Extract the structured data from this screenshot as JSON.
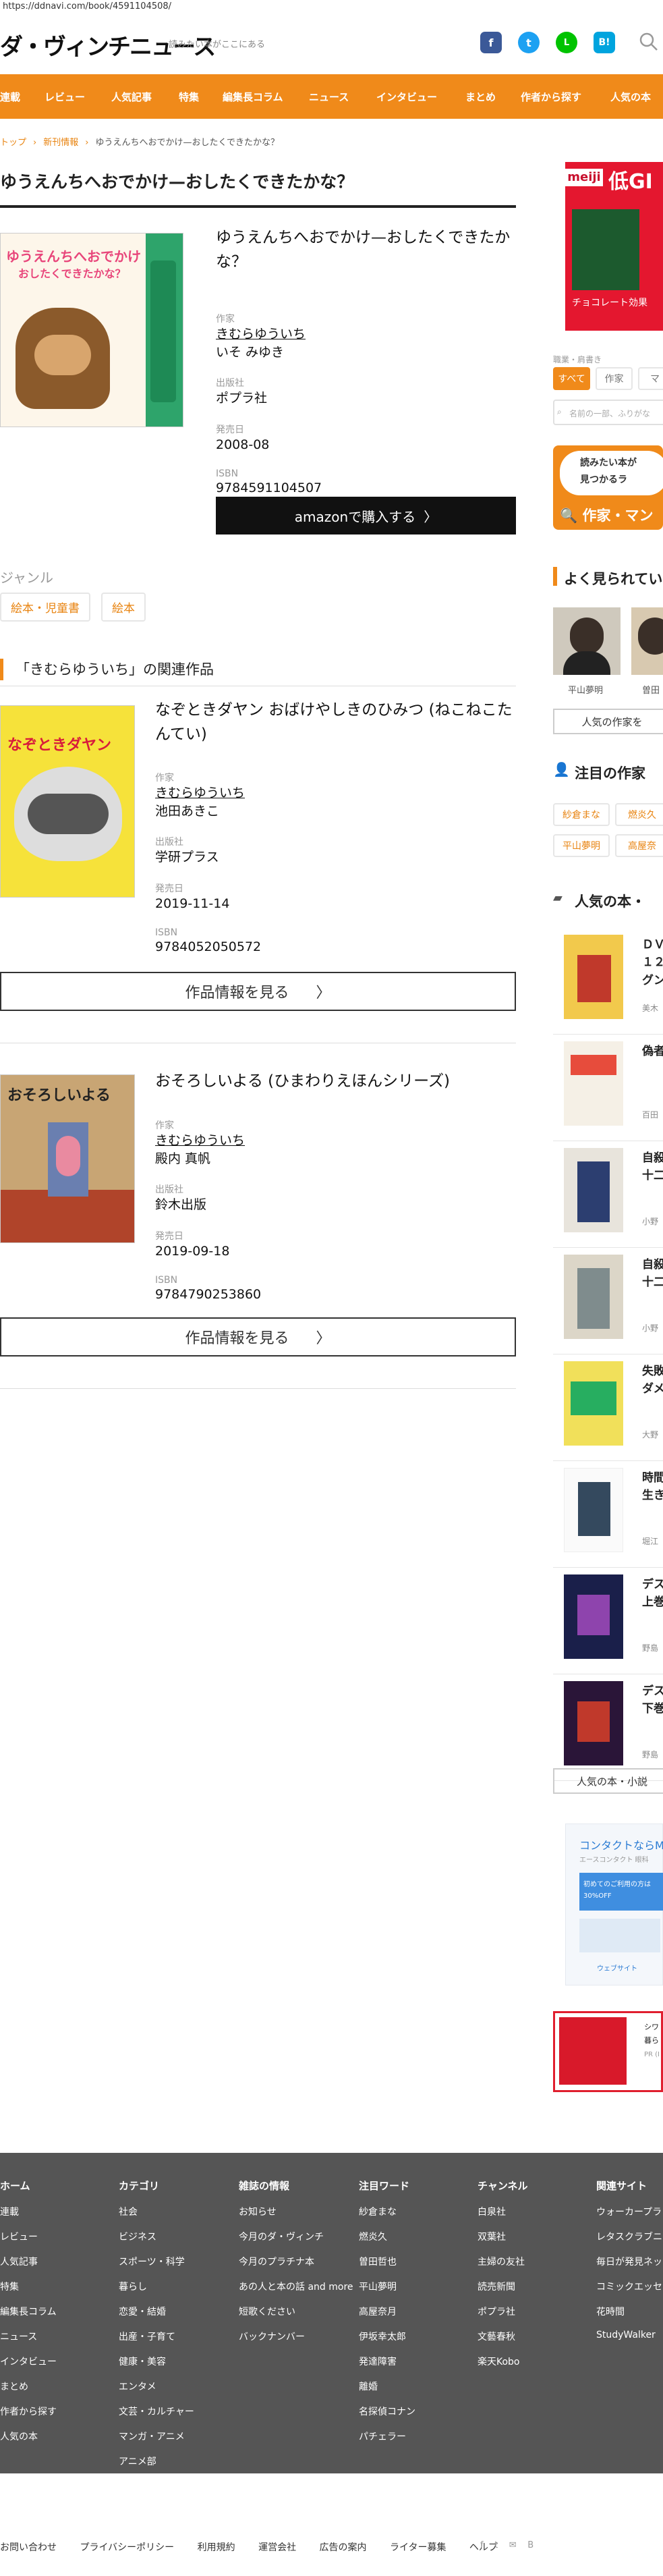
{
  "url": "https://ddnavi.com/book/4591104508/",
  "site": {
    "logo": "ダ・ヴィンチニュース",
    "tagline": "読みたい本がここにある"
  },
  "social": {
    "facebook": "f",
    "twitter": "t",
    "line": "L",
    "hatena": "B!"
  },
  "nav": [
    "連載",
    "レビュー",
    "人気記事",
    "特集",
    "編集長コラム",
    "ニュース",
    "インタビュー",
    "まとめ",
    "作者から探す",
    "人気の本"
  ],
  "breadcrumb": {
    "home": "トップ",
    "category": "新刊情報",
    "current": "ゆうえんちへおでかけ—おしたくできたかな？"
  },
  "page_title": "ゆうえんちへおでかけ—おしたくできたかな？",
  "book": {
    "title": "ゆうえんちへおでかけ—おしたくできたかな？",
    "cover_text_line1": "ゆうえんちへおでかけ",
    "cover_text_line2": "おしたくできたかな？",
    "author_label": "作家",
    "authors": [
      "きむらゆういち",
      "いそ みゆき"
    ],
    "publisher_label": "出版社",
    "publisher": "ポプラ社",
    "date_label": "発売日",
    "date": "2008-08",
    "isbn_label": "ISBN",
    "isbn": "9784591104507",
    "amazon_button": "amazonで購入する",
    "amazon_arrow": "〉"
  },
  "genre": {
    "label": "ジャンル",
    "tags": [
      "絵本・児童書",
      "絵本"
    ]
  },
  "related": {
    "heading": "「きむらゆういち」の関連作品",
    "button_label": "作品情報を見る",
    "button_arrow": "〉",
    "items": [
      {
        "title": "なぞときダヤン おばけやしきのひみつ (ねこねこたんてい)",
        "cover_text": "なぞときダヤン",
        "author_label": "作家",
        "authors": [
          "きむらゆういち",
          "池田あきこ"
        ],
        "publisher_label": "出版社",
        "publisher": "学研プラス",
        "date_label": "発売日",
        "date": "2019-11-14",
        "isbn_label": "ISBN",
        "isbn": "9784052050572"
      },
      {
        "title": "おそろしいよる (ひまわりえほんシリーズ)",
        "cover_text": "おそろしいよる",
        "author_label": "作家",
        "authors": [
          "きむらゆういち",
          "殿内 真帆"
        ],
        "publisher_label": "出版社",
        "publisher": "鈴木出版",
        "date_label": "発売日",
        "date": "2019-09-18",
        "isbn_label": "ISBN",
        "isbn": "9784790253860"
      }
    ]
  },
  "sidebar": {
    "ad_top": {
      "brand": "meiji",
      "headline": "低GI",
      "caption": "チョコレート効果"
    },
    "search": {
      "label": "職業・肩書き",
      "filters": [
        "すべて",
        "作家",
        "マ"
      ],
      "placeholder": "名前の一部、ふりがな"
    },
    "banner": {
      "line1": "読みたい本が",
      "line2": "見つかるラ",
      "cta": "作家・マン"
    },
    "popular_authors": {
      "heading": "よく見られてい",
      "names": [
        "平山夢明",
        "曽田"
      ],
      "button": "人気の作家を"
    },
    "featured_authors": {
      "heading": "注目の作家",
      "tags": [
        "紗倉まな",
        "燃炎久",
        "平山夢明",
        "高屋奈"
      ]
    },
    "popular_books": {
      "heading": "人気の本・",
      "button": "人気の本・小説",
      "items": [
        {
          "title1": "ＤＶ",
          "title2": "１２",
          "title3": "グン",
          "author": "美木"
        },
        {
          "title1": "偽者",
          "title2": "",
          "title3": "",
          "author": "百田"
        },
        {
          "title1": "自殺",
          "title2": "十二",
          "title3": "",
          "author": "小野"
        },
        {
          "title1": "自殺",
          "title2": "十二",
          "title3": "",
          "author": "小野"
        },
        {
          "title1": "失敗",
          "title2": "ダメ",
          "title3": "",
          "author": "大野"
        },
        {
          "title1": "時間",
          "title2": "生き",
          "title3": "",
          "author": "堀江"
        },
        {
          "title1": "デス",
          "title2": "上巻",
          "title3": "",
          "author": "野島"
        },
        {
          "title1": "デス",
          "title2": "下巻",
          "title3": "",
          "author": "野島"
        }
      ]
    },
    "ad_mid": {
      "title": "コンタクトならM",
      "sub": "エースコンタクト 眼科",
      "body1": "初めてのご利用の方は",
      "body2": "30%OFF",
      "brand": "ウェブサイト"
    },
    "ad_bottom": {
      "line1": "シワ",
      "line2": "暮ら",
      "pr": "PR (I"
    }
  },
  "footer": {
    "columns": [
      {
        "heading": "ホーム",
        "items": [
          "連載",
          "レビュー",
          "人気記事",
          "特集",
          "編集長コラム",
          "ニュース",
          "インタビュー",
          "まとめ",
          "作者から探す",
          "人気の本"
        ]
      },
      {
        "heading": "カテゴリ",
        "items": [
          "社会",
          "ビジネス",
          "スポーツ・科学",
          "暮らし",
          "恋愛・結婚",
          "出産・子育て",
          "健康・美容",
          "エンタメ",
          "文芸・カルチャー",
          "マンガ・アニメ",
          "アニメ部"
        ]
      },
      {
        "heading": "雑誌の情報",
        "items": [
          "お知らせ",
          "今月のダ・ヴィンチ",
          "今月のプラチナ本",
          "あの人と本の話 and more",
          "短歌ください",
          "バックナンバー"
        ]
      },
      {
        "heading": "注目ワード",
        "items": [
          "紗倉まな",
          "燃炎久",
          "曽田哲也",
          "平山夢明",
          "高屋奈月",
          "伊坂幸太郎",
          "発達障害",
          "離婚",
          "名探偵コナン",
          "パチェラー"
        ]
      },
      {
        "heading": "チャンネル",
        "items": [
          "白泉社",
          "双葉社",
          "主婦の友社",
          "読売新聞",
          "ポプラ社",
          "文藝春秋",
          "楽天Kobo"
        ]
      },
      {
        "heading": "関連サイト",
        "items": [
          "ウォーカープラ",
          "レタスクラブニ",
          "毎日が発見ネッ",
          "コミックエッセ",
          "花時間",
          "StudyWalker"
        ]
      }
    ]
  },
  "bottom_links": [
    "お問い合わせ",
    "プライバシーポリシー",
    "利用規約",
    "運営会社",
    "広告の案内",
    "ライター募集",
    "ヘルプ"
  ],
  "colors": {
    "accent": "#f08a1a",
    "link": "#e8830f",
    "footer_bg": "#555555",
    "amazon_btn": "#111111"
  }
}
